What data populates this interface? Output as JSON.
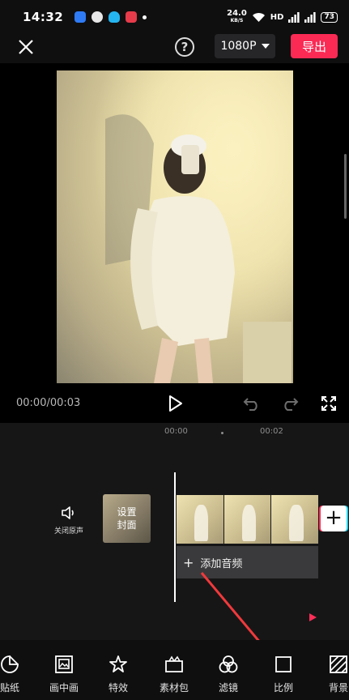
{
  "status_bar": {
    "time": "14:32",
    "net_speed": "24.0",
    "net_speed_unit": "KB/S",
    "hd": "HD",
    "battery": "73"
  },
  "top_bar": {
    "help": "?",
    "resolution": "1080P",
    "export": "导出"
  },
  "player": {
    "time": "00:00/00:03"
  },
  "timeline": {
    "ticks": [
      "00:00",
      "00:02"
    ],
    "mute_label": "关闭原声",
    "cover_label": "设置\n封面",
    "add_audio": "添加音频",
    "add_clip": "+"
  },
  "toolbar": {
    "items": [
      "贴纸",
      "画中画",
      "特效",
      "素材包",
      "滤镜",
      "比例",
      "背景"
    ]
  },
  "colors": {
    "accent": "#fa2a55",
    "background": "#0f0f10"
  }
}
